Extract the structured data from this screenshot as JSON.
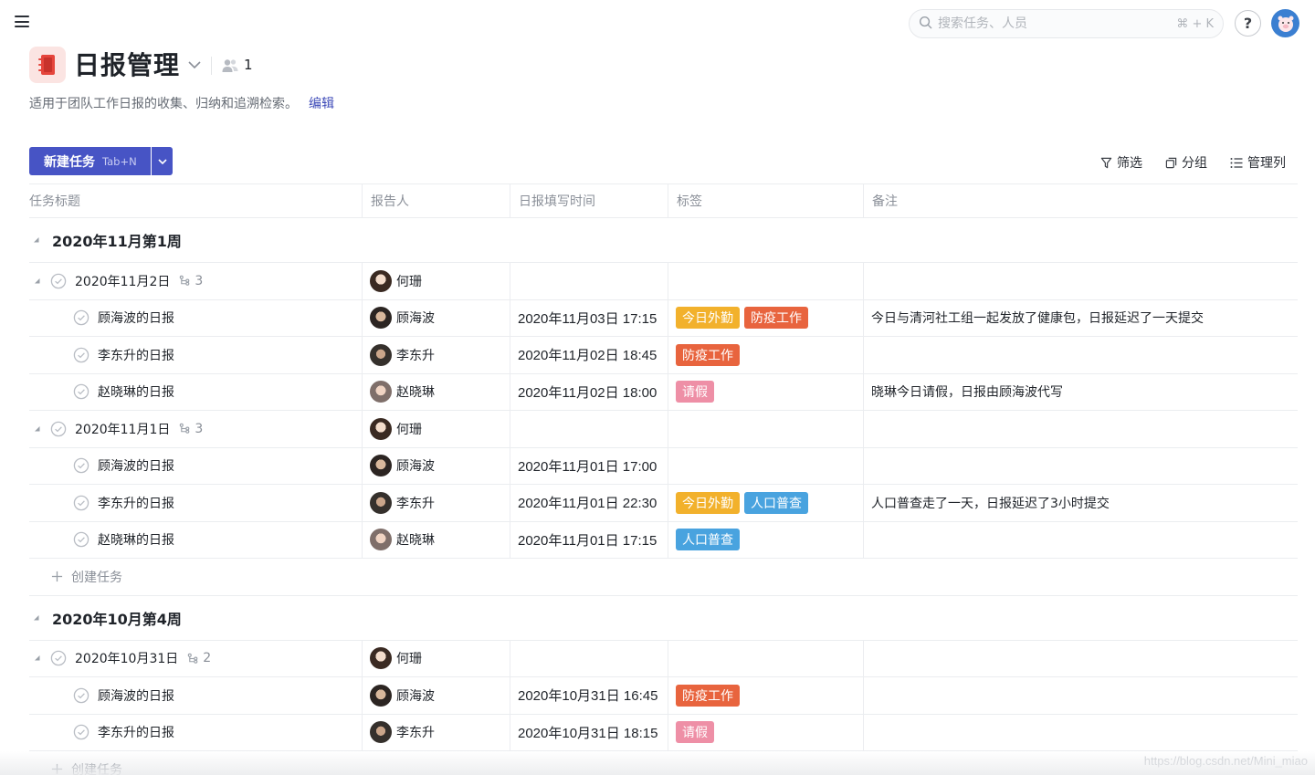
{
  "topbar": {
    "search_placeholder": "搜索任务、人员",
    "search_shortcut": "⌘ + K",
    "help_label": "?"
  },
  "project": {
    "title": "日报管理",
    "member_count": "1",
    "description": "适用于团队工作日报的收集、归纳和追溯检索。",
    "edit_label": "编辑"
  },
  "toolbar": {
    "new_task_label": "新建任务",
    "new_task_shortcut": "Tab+N",
    "filter_label": "筛选",
    "group_label": "分组",
    "manage_columns_label": "管理列"
  },
  "table": {
    "columns": [
      "任务标题",
      "报告人",
      "日报填写时间",
      "标签",
      "备注"
    ],
    "create_task_label": "创建任务"
  },
  "groups": [
    {
      "title": "2020年11月第1周",
      "parents": [
        {
          "title": "2020年11月2日",
          "subtask_count": "3",
          "reporter": "何珊",
          "children": [
            {
              "title": "顾海波的日报",
              "reporter": "顾海波",
              "time": "2020年11月03日 17:15",
              "tags": [
                "今日外勤",
                "防疫工作"
              ],
              "note": "今日与清河社工组一起发放了健康包，日报延迟了一天提交"
            },
            {
              "title": "李东升的日报",
              "reporter": "李东升",
              "time": "2020年11月02日 18:45",
              "tags": [
                "防疫工作"
              ],
              "note": ""
            },
            {
              "title": "赵晓琳的日报",
              "reporter": "赵晓琳",
              "time": "2020年11月02日 18:00",
              "tags": [
                "请假"
              ],
              "note": "晓琳今日请假，日报由顾海波代写"
            }
          ]
        },
        {
          "title": "2020年11月1日",
          "subtask_count": "3",
          "reporter": "何珊",
          "children": [
            {
              "title": "顾海波的日报",
              "reporter": "顾海波",
              "time": "2020年11月01日 17:00",
              "tags": [],
              "note": ""
            },
            {
              "title": "李东升的日报",
              "reporter": "李东升",
              "time": "2020年11月01日 22:30",
              "tags": [
                "今日外勤",
                "人口普查"
              ],
              "note": "人口普查走了一天，日报延迟了3小时提交"
            },
            {
              "title": "赵晓琳的日报",
              "reporter": "赵晓琳",
              "time": "2020年11月01日 17:15",
              "tags": [
                "人口普查"
              ],
              "note": ""
            }
          ]
        }
      ]
    },
    {
      "title": "2020年10月第4周",
      "parents": [
        {
          "title": "2020年10月31日",
          "subtask_count": "2",
          "reporter": "何珊",
          "children": [
            {
              "title": "顾海波的日报",
              "reporter": "顾海波",
              "time": "2020年10月31日 16:45",
              "tags": [
                "防疫工作"
              ],
              "note": ""
            },
            {
              "title": "李东升的日报",
              "reporter": "李东升",
              "time": "2020年10月31日 18:15",
              "tags": [
                "请假"
              ],
              "note": ""
            }
          ]
        }
      ]
    }
  ],
  "tag_colors": {
    "今日外勤": "#f2b12c",
    "防疫工作": "#e8643e",
    "请假": "#ee8fa6",
    "人口普查": "#49a3df"
  },
  "brand_color": "#4754c5",
  "watermark": "https://blog.csdn.net/Mini_miao"
}
